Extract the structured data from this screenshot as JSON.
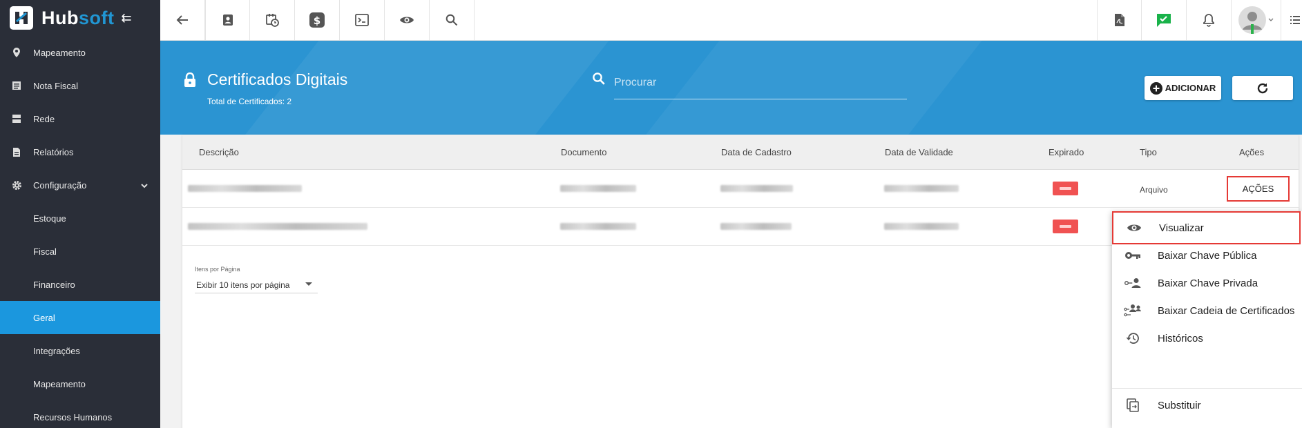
{
  "brand": {
    "name_a": "Hub",
    "name_b": "soft"
  },
  "sidebar": {
    "items": [
      {
        "label": "Mapeamento"
      },
      {
        "label": "Nota Fiscal"
      },
      {
        "label": "Rede"
      },
      {
        "label": "Relatórios"
      },
      {
        "label": "Configuração"
      },
      {
        "label": "Estoque"
      },
      {
        "label": "Fiscal"
      },
      {
        "label": "Financeiro"
      },
      {
        "label": "Geral"
      },
      {
        "label": "Integrações"
      },
      {
        "label": "Mapeamento"
      },
      {
        "label": "Recursos Humanos"
      }
    ]
  },
  "header": {
    "title": "Certificados Digitais",
    "subtitle": "Total de Certificados: 2",
    "search_placeholder": "Procurar",
    "add_label": "ADICIONAR"
  },
  "table": {
    "columns": [
      "Descrição",
      "Documento",
      "Data de Cadastro",
      "Data de Validade",
      "Expirado",
      "Tipo",
      "Ações"
    ],
    "rows": [
      {
        "tipo": "Arquivo",
        "acoes": "AÇÕES"
      },
      {
        "tipo": "",
        "acoes": ""
      }
    ]
  },
  "pagination": {
    "label": "Itens por Página",
    "selected": "Exibir 10 itens por página"
  },
  "actions_menu": {
    "items": [
      {
        "label": "Visualizar",
        "icon": "eye-icon"
      },
      {
        "label": "Baixar Chave Pública",
        "icon": "key-icon"
      },
      {
        "label": "Baixar Chave Privada",
        "icon": "person-key-icon"
      },
      {
        "label": "Baixar Cadeia de Certificados",
        "icon": "people-chain-icon"
      },
      {
        "label": "Históricos",
        "icon": "history-icon"
      },
      {
        "label": "Substituir",
        "icon": "replace-icon"
      }
    ]
  },
  "colors": {
    "sidebar": "#2a2e38",
    "accent": "#1b97de",
    "hero": "#2b94d2",
    "highlight": "#e53935"
  }
}
